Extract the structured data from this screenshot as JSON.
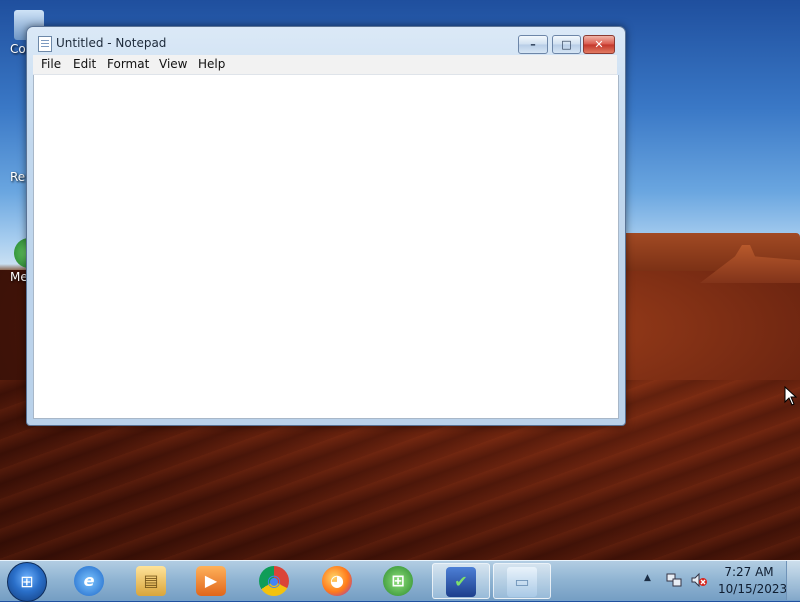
{
  "desktop": {
    "icons": [
      {
        "label": "Co",
        "icon": "computer-icon"
      },
      {
        "label": "Re",
        "icon": "recycle-bin-icon"
      },
      {
        "label": "Med",
        "icon": "media-icon"
      }
    ]
  },
  "window": {
    "title": "Untitled - Notepad",
    "app_icon": "notepad-icon",
    "minimize_label": "–",
    "maximize_label": "□",
    "close_label": "✕",
    "menu": [
      "File",
      "Edit",
      "Format",
      "View",
      "Help"
    ],
    "content": ""
  },
  "taskbar": {
    "start_icon": "windows-start-icon",
    "pinned": [
      {
        "name": "internet-explorer",
        "icon": "ie-icon",
        "glyph": "e"
      },
      {
        "name": "file-explorer",
        "icon": "folder-icon",
        "glyph": "▤"
      },
      {
        "name": "media-player",
        "icon": "media-player-icon",
        "glyph": "▶"
      },
      {
        "name": "chrome",
        "icon": "chrome-icon",
        "glyph": "◉"
      },
      {
        "name": "firefox",
        "icon": "firefox-icon",
        "glyph": "◕"
      },
      {
        "name": "windows-media-center",
        "icon": "media-center-icon",
        "glyph": "⊞"
      },
      {
        "name": "action-center",
        "icon": "action-center-icon",
        "glyph": "✔"
      },
      {
        "name": "notepad",
        "icon": "notepad-icon",
        "glyph": "▭"
      }
    ],
    "tray": {
      "show_hidden_icon": "▲",
      "network_icon": "network-icon",
      "volume_icon": "volume-muted-icon",
      "time": "7:27 AM",
      "date": "10/15/2023"
    }
  }
}
